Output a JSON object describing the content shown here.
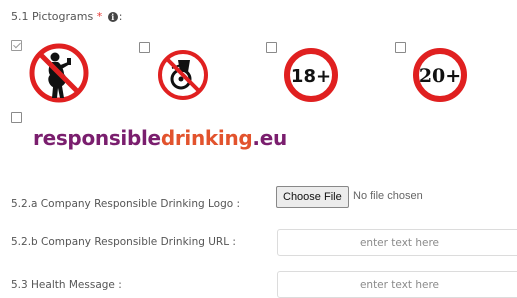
{
  "section": {
    "heading": "5.1 Pictograms",
    "required_marker": "*",
    "info_icon": "info-circle-icon",
    "colon": ":"
  },
  "pictograms": [
    {
      "name": "no-pregnant-drinking-pictogram",
      "checked": true
    },
    {
      "name": "no-drink-driving-pictogram",
      "checked": false
    },
    {
      "name": "18-plus-pictogram",
      "label": "18+",
      "checked": false
    },
    {
      "name": "20-plus-pictogram",
      "label": "20+",
      "checked": false
    },
    {
      "name": "responsible-drinking-logo",
      "checked": false
    }
  ],
  "logo": {
    "part1": "responsible",
    "part2": "drinking",
    "part3": ".eu"
  },
  "fields": {
    "logo_label": "5.2.a Company Responsible Drinking Logo :",
    "choose_file": "Choose File",
    "file_status": "No file chosen",
    "url_label": "5.2.b Company Responsible Drinking URL :",
    "url_placeholder": "enter text here",
    "health_label": "5.3 Health Message :",
    "health_placeholder": "enter text here"
  },
  "colors": {
    "ban_red": "#e02020",
    "logo_purple": "#7a1e6e",
    "logo_orange": "#e2532d"
  }
}
